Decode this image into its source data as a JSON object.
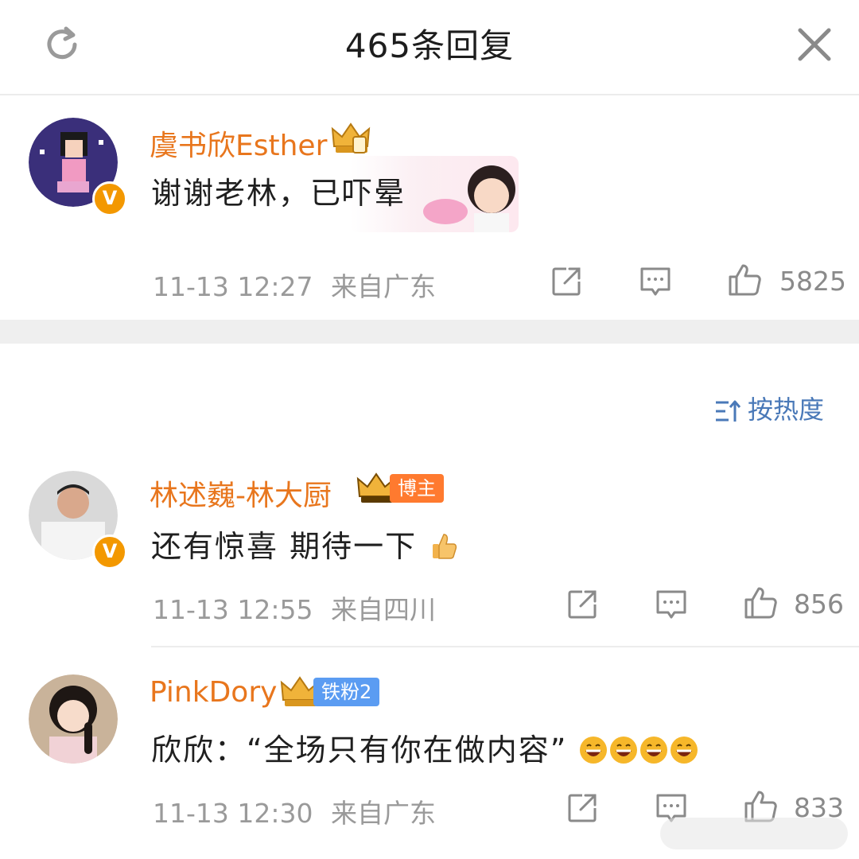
{
  "header": {
    "title": "465条回复",
    "refresh_icon": "refresh-icon",
    "close_icon": "close-icon"
  },
  "root_comment": {
    "username": "虞书欣Esther",
    "verified": "V",
    "text": "谢谢老林，已吓晕",
    "time": "11-13 12:27",
    "location": "来自广东",
    "likes": "5825"
  },
  "sort": {
    "label": "按热度",
    "icon": "sort-icon"
  },
  "replies": [
    {
      "username": "林述巍-林大厨",
      "tag": "博主",
      "verified": "V",
      "text": "还有惊喜 期待一下",
      "time": "11-13 12:55",
      "location": "来自四川",
      "likes": "856"
    },
    {
      "username": "PinkDory",
      "tag": "铁粉2",
      "text": "欣欣：“全场只有你在做内容”",
      "time": "11-13 12:30",
      "location": "来自广东",
      "likes": "833"
    }
  ],
  "colors": {
    "username": "#e8761d",
    "verified_badge": "#f39800",
    "sort_link": "#4a79b8",
    "meta_text": "#9a9a9a"
  }
}
